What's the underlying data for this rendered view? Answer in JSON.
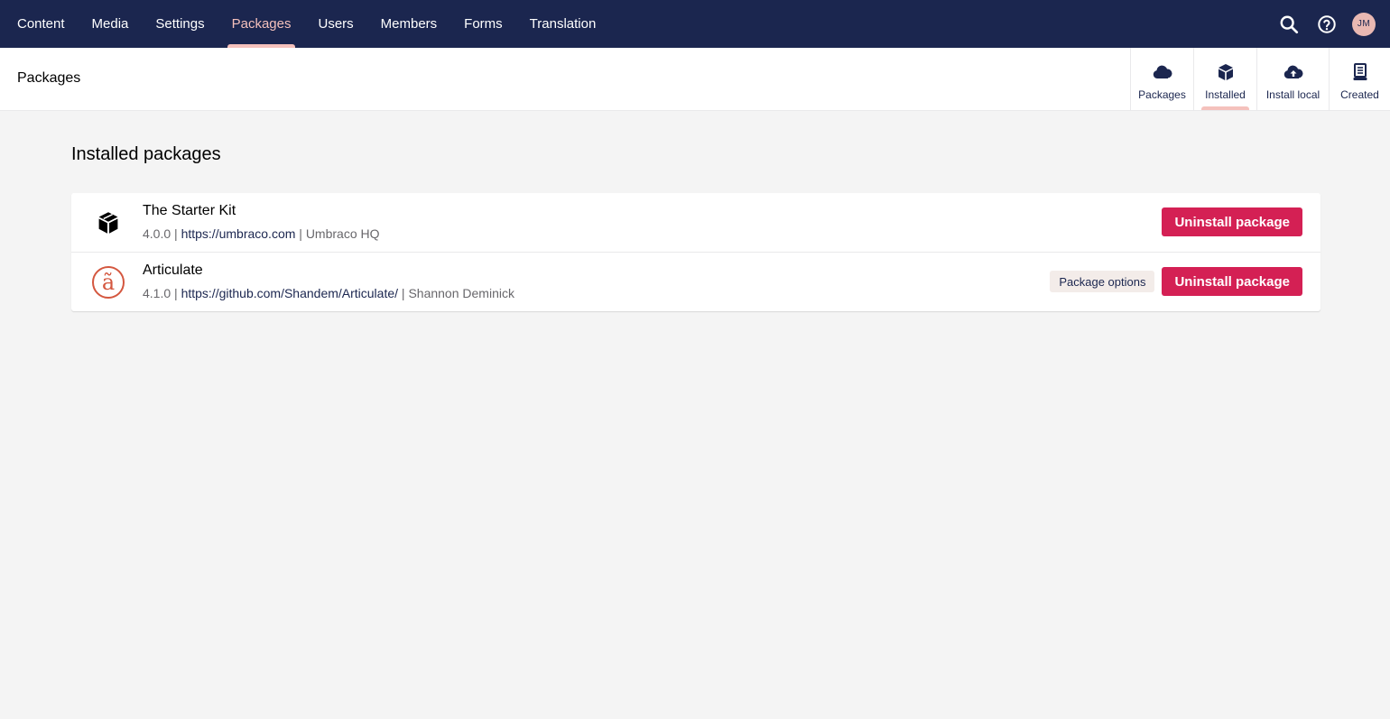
{
  "nav": {
    "items": [
      {
        "label": "Content",
        "active": false
      },
      {
        "label": "Media",
        "active": false
      },
      {
        "label": "Settings",
        "active": false
      },
      {
        "label": "Packages",
        "active": true
      },
      {
        "label": "Users",
        "active": false
      },
      {
        "label": "Members",
        "active": false
      },
      {
        "label": "Forms",
        "active": false
      },
      {
        "label": "Translation",
        "active": false
      }
    ],
    "avatar_initials": "JM",
    "icons": [
      "search-icon",
      "help-icon"
    ]
  },
  "header": {
    "title": "Packages",
    "apps": [
      {
        "label": "Packages",
        "icon": "cloud-icon",
        "active": false
      },
      {
        "label": "Installed",
        "icon": "box-icon",
        "active": true
      },
      {
        "label": "Install local",
        "icon": "cloud-upload-icon",
        "active": false
      },
      {
        "label": "Created",
        "icon": "document-stack-icon",
        "active": false
      }
    ]
  },
  "main": {
    "section_title": "Installed packages",
    "packages": [
      {
        "name": "The Starter Kit",
        "version": "4.0.0",
        "url": "https://umbraco.com",
        "author": "Umbraco HQ",
        "icon": "box-icon",
        "uninstall_label": "Uninstall package"
      },
      {
        "name": "Articulate",
        "version": "4.1.0",
        "url": "https://github.com/Shandem/Articulate/",
        "author": "Shannon Deminick",
        "icon": "articulate-logo",
        "logo_glyph": "ã",
        "options_label": "Package options",
        "uninstall_label": "Uninstall package"
      }
    ]
  },
  "colors": {
    "topbar": "#1b264f",
    "accent_active": "#f5c1bc",
    "danger": "#d42054",
    "articulate": "#d4573f"
  }
}
